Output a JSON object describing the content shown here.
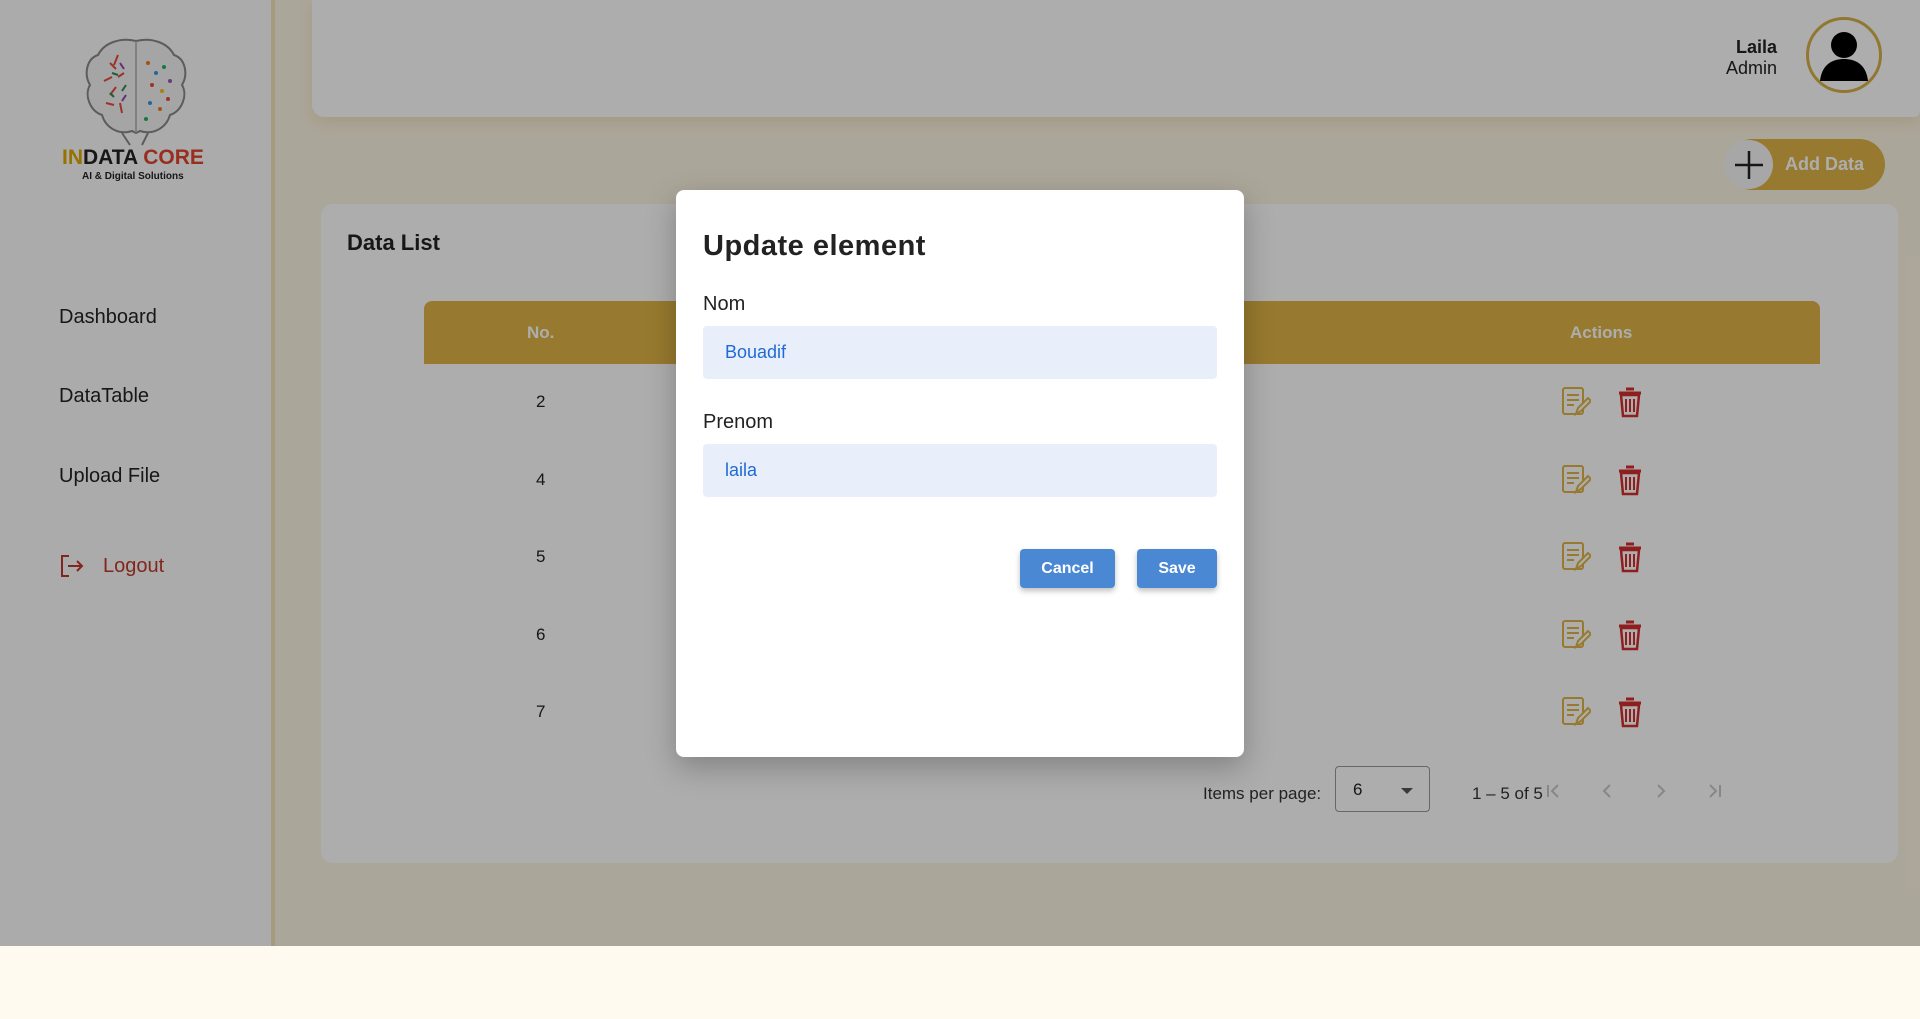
{
  "brand": {
    "name_part1": "IN",
    "name_part2": "DATA ",
    "name_part3": "CORE",
    "tagline": "AI & Digital Solutions"
  },
  "sidebar": {
    "items": [
      {
        "label": "Dashboard"
      },
      {
        "label": "DataTable"
      },
      {
        "label": "Upload File"
      }
    ],
    "logout_label": "Logout"
  },
  "user": {
    "name": "Laila",
    "role": "Admin"
  },
  "add_data_label": "Add Data",
  "data_list": {
    "title": "Data List",
    "columns": [
      "No.",
      "Actions"
    ],
    "rows": [
      {
        "no": "2"
      },
      {
        "no": "4"
      },
      {
        "no": "5"
      },
      {
        "no": "6"
      },
      {
        "no": "7"
      }
    ]
  },
  "paginator": {
    "items_per_page_label": "Items per page:",
    "items_per_page_value": "6",
    "range_label": "1 – 5 of 5"
  },
  "modal": {
    "title": "Update element",
    "fields": [
      {
        "label": "Nom",
        "value": "Bouadif"
      },
      {
        "label": "Prenom",
        "value": "laila"
      }
    ],
    "cancel_label": "Cancel",
    "save_label": "Save"
  },
  "colors": {
    "accent": "#dfb446",
    "logout": "#c0392b",
    "button": "#4a88d4",
    "delete": "#d32f2f"
  }
}
